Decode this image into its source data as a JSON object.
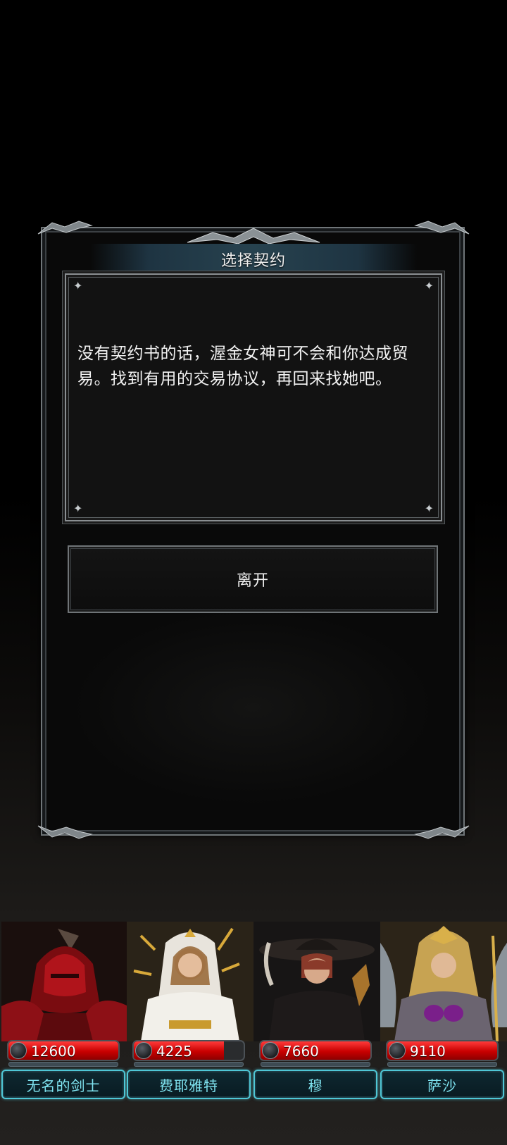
{
  "dialog": {
    "title": "选择契约",
    "message": "没有契约书的话，渥金女神可不会和你达成贸易。找到有用的交易协议，再回来找她吧。",
    "leave_button": "离开"
  },
  "party": [
    {
      "name": "无名的剑士",
      "hp": "12600",
      "hp_fill": 1.0,
      "portrait": "red-armored-knight"
    },
    {
      "name": "费耶雅特",
      "hp": "4225",
      "hp_fill": 0.82,
      "portrait": "white-robed-priestess"
    },
    {
      "name": "穆",
      "hp": "7660",
      "hp_fill": 1.0,
      "portrait": "hatted-assassin"
    },
    {
      "name": "萨沙",
      "hp": "9110",
      "hp_fill": 1.0,
      "portrait": "winged-valkyrie"
    }
  ],
  "colors": {
    "hp_red": "#d40000",
    "name_plate_border": "#4fc7d6",
    "name_text": "#7fe3f0",
    "title_banner": "#27424f"
  }
}
